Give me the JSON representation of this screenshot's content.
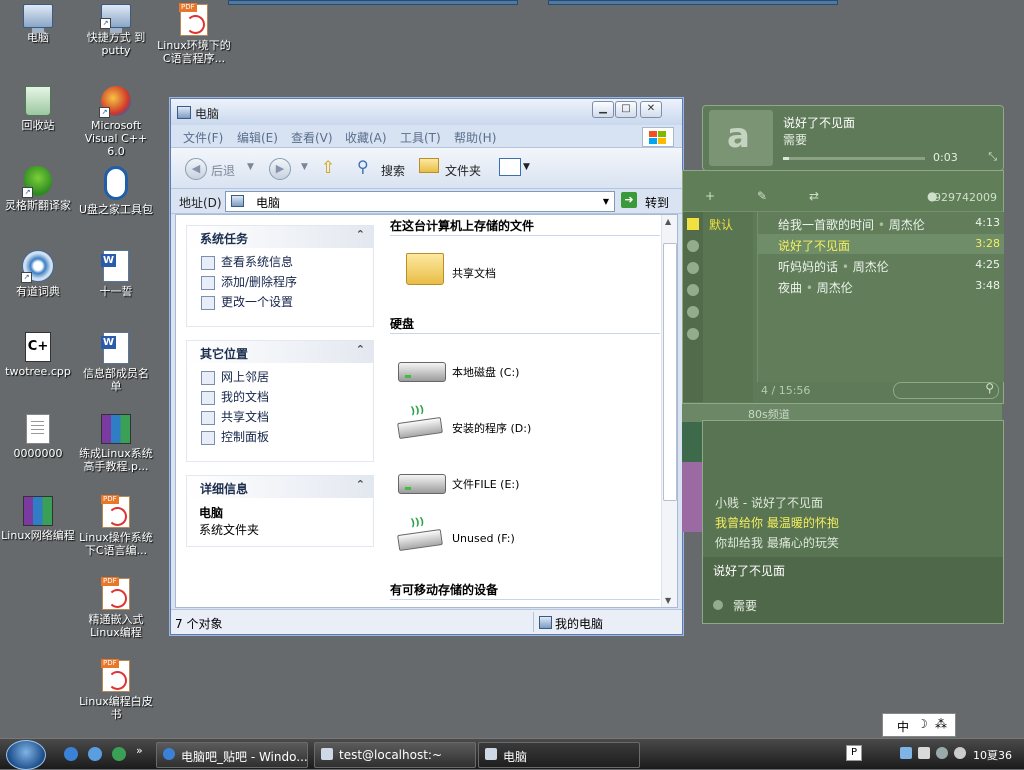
{
  "desktop": {
    "icons": [
      {
        "label": "电脑"
      },
      {
        "label": "快捷方式 到 putty"
      },
      {
        "label": "Linux环境下的C语言程序..."
      },
      {
        "label": "回收站"
      },
      {
        "label": "Microsoft Visual C++ 6.0"
      },
      {
        "label": "灵格斯翻译家"
      },
      {
        "label": "U盘之家工具包"
      },
      {
        "label": "有道词典"
      },
      {
        "label": "十一誓"
      },
      {
        "label": "twotree.cpp"
      },
      {
        "label": "信息部成员名单"
      },
      {
        "label": "0000000"
      },
      {
        "label": "练成Linux系统高手教程.p..."
      },
      {
        "label": "Linux网络编程"
      },
      {
        "label": "Linux操作系统下C语言编..."
      },
      {
        "label": "精通嵌入式Linux编程"
      },
      {
        "label": "Linux编程白皮书"
      }
    ]
  },
  "explorer": {
    "title": "电脑",
    "menu": {
      "file": "文件(F)",
      "edit": "编辑(E)",
      "view": "查看(V)",
      "favorites": "收藏(A)",
      "tools": "工具(T)",
      "help": "帮助(H)"
    },
    "toolbar": {
      "back": "后退",
      "search": "搜索",
      "folders": "文件夹"
    },
    "address": {
      "label": "地址(D)",
      "value": "电脑",
      "go": "转到"
    },
    "tasks": {
      "system": {
        "title": "系统任务",
        "items": [
          "查看系统信息",
          "添加/删除程序",
          "更改一个设置"
        ]
      },
      "other": {
        "title": "其它位置",
        "items": [
          "网上邻居",
          "我的文档",
          "共享文档",
          "控制面板"
        ]
      },
      "details": {
        "title": "详细信息",
        "name": "电脑",
        "type": "系统文件夹"
      }
    },
    "groups": {
      "stored": "在这台计算机上存储的文件",
      "disks": "硬盘",
      "removable": "有可移动存储的设备"
    },
    "items": {
      "shared": "共享文档",
      "c": "本地磁盘 (C:)",
      "d": "安装的程序 (D:)",
      "e": "文件FILE (E:)",
      "f": "Unused (F:)"
    },
    "status": {
      "count": "7 个对象",
      "location": "我的电脑"
    }
  },
  "player": {
    "now_playing": {
      "title": "说好了不见面",
      "artist": "需要",
      "time": "0:03",
      "progress": 0.04
    },
    "user_id": "929742009",
    "sidebar_label": "默认",
    "playlist": [
      {
        "title": "给我一首歌的时间",
        "artist": "周杰伦",
        "duration": "4:13",
        "active": false
      },
      {
        "title": "说好了不见面",
        "artist": "",
        "duration": "3:28",
        "active": true
      },
      {
        "title": "听妈妈的话",
        "artist": "周杰伦",
        "duration": "4:25",
        "active": false
      },
      {
        "title": "夜曲",
        "artist": "周杰伦",
        "duration": "3:48",
        "active": false
      }
    ],
    "summary": "4 / 15:56",
    "channel": "80s频道",
    "lyrics": {
      "header": "小贱 - 说好了不见面",
      "lines": [
        "我曾给你 最温暖的怀抱",
        "你却给我 最痛心的玩笑"
      ],
      "footer_title": "说好了不见面",
      "footer_artist": "需要"
    }
  },
  "taskbar": {
    "tasks": [
      "电脑吧_贴吧 - Windo...",
      "test@localhost:~",
      "电脑"
    ],
    "clock": "10夏36",
    "ime": "中"
  }
}
